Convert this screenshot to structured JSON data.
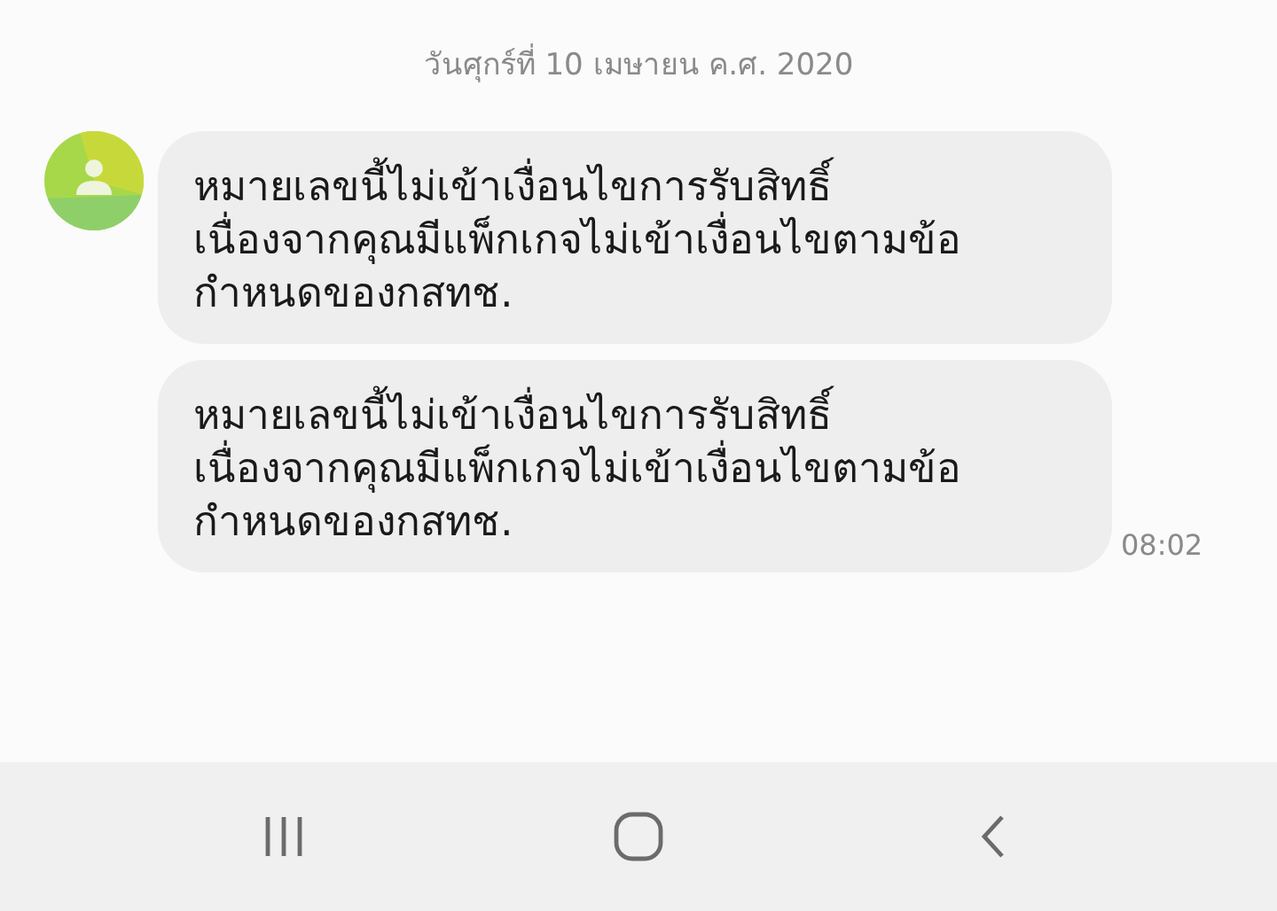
{
  "date_header": "วันศุกร์ที่ 10 เมษายน ค.ศ. 2020",
  "messages": [
    {
      "lines": [
        "หมายเลขนี้ไม่เข้าเงื่อนไขการรับสิทธิ์",
        "เนื่องจากคุณมีแพ็กเกจไม่เข้าเงื่อนไขตามข้อ",
        "กำหนดของกสทช."
      ],
      "show_avatar": true
    },
    {
      "lines": [
        "หมายเลขนี้ไม่เข้าเงื่อนไขการรับสิทธิ์",
        "เนื่องจากคุณมีแพ็กเกจไม่เข้าเงื่อนไขตามข้อ",
        "กำหนดของกสทช."
      ],
      "show_avatar": false,
      "time": "08:02"
    }
  ]
}
